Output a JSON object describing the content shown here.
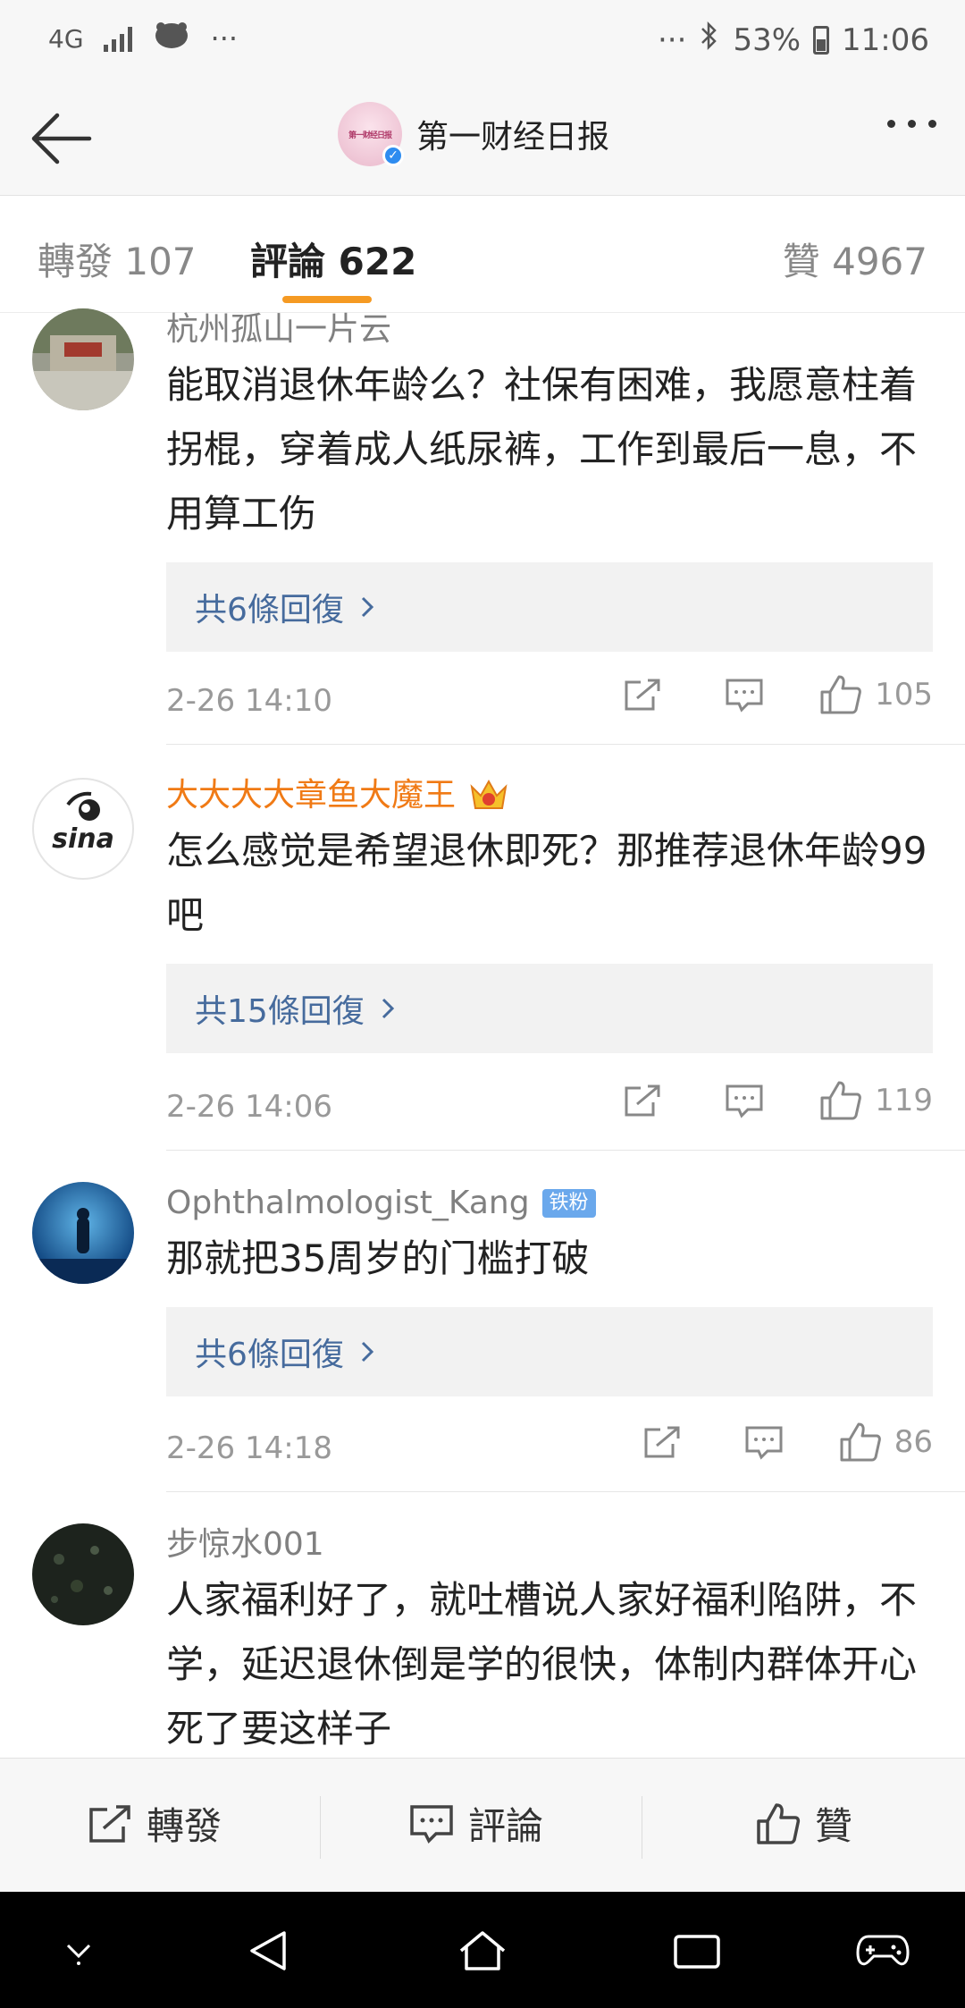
{
  "status_bar": {
    "network": "4G",
    "more": "···",
    "more_right": "···",
    "battery": "53%",
    "time": "11:06"
  },
  "header": {
    "logo_text": "第一财经日报",
    "title": "第一财经日报"
  },
  "tabs": {
    "repost": "轉發 107",
    "comment": "評論 622",
    "like": "贊 4967"
  },
  "comments": [
    {
      "user": "杭州孤山一片云",
      "text": "能取消退休年龄么？社保有困难，我愿意柱着拐棍，穿着成人纸尿裤，工作到最后一息，不用算工伤",
      "replies": "共6條回復",
      "time": "2-26 14:10",
      "likes": "105"
    },
    {
      "user": "大大大大章鱼大魔王",
      "text": "怎么感觉是希望退休即死？那推荐退休年龄99吧",
      "replies": "共15條回復",
      "time": "2-26 14:06",
      "likes": "119"
    },
    {
      "user": "Ophthalmologist_Kang",
      "badge": "铁粉",
      "text": "那就把35周岁的门槛打破",
      "replies": "共6條回復",
      "time": "2-26 14:18",
      "likes": "86"
    },
    {
      "user": "步惊水001",
      "text": "人家福利好了，就吐槽说人家好福利陷阱，不学，延迟退休倒是学的很快，体制内群体开心死了要这样子"
    }
  ],
  "bottom_bar": {
    "repost": "轉發",
    "comment": "評論",
    "like": "贊"
  },
  "colors": {
    "accent": "#f59a23",
    "link": "#466b9d",
    "vip_name": "#f07a15"
  }
}
